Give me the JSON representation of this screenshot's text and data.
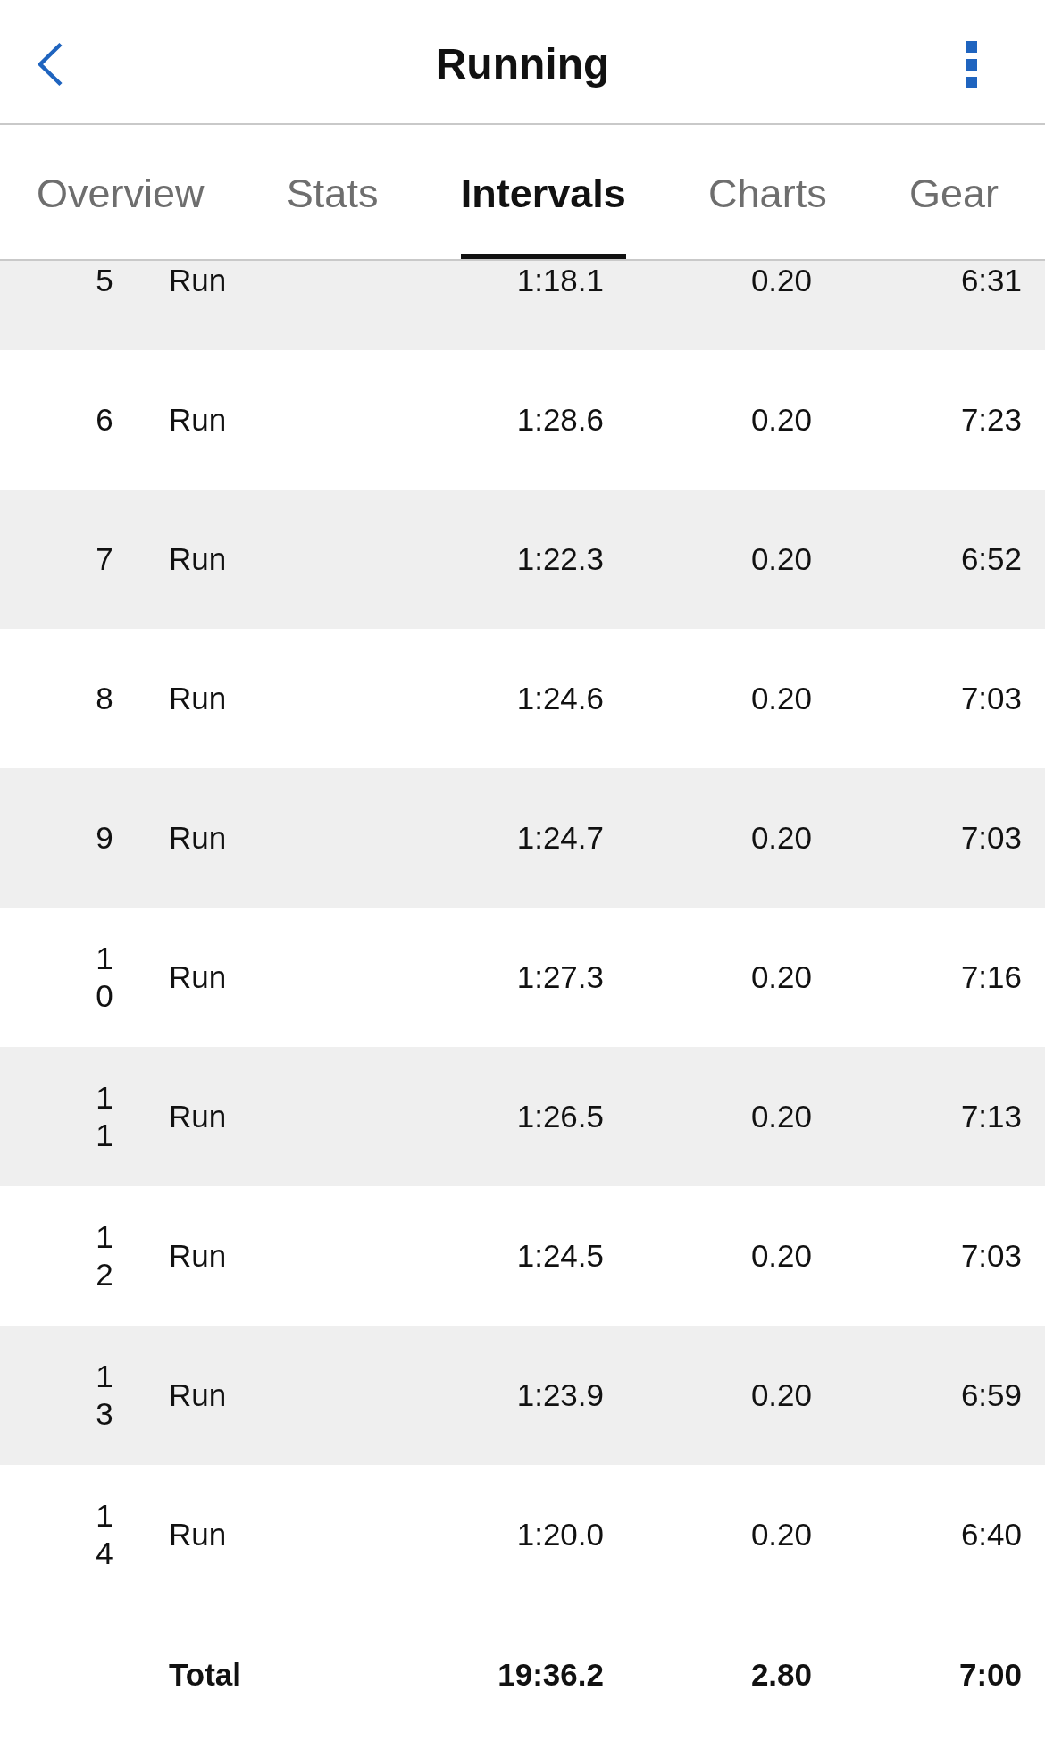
{
  "header": {
    "title": "Running"
  },
  "tabs": [
    {
      "label": "Overview",
      "selected": false
    },
    {
      "label": "Stats",
      "selected": false
    },
    {
      "label": "Intervals",
      "selected": true
    },
    {
      "label": "Charts",
      "selected": false
    },
    {
      "label": "Gear",
      "selected": false
    }
  ],
  "table": {
    "rows": [
      {
        "cells": [
          "5",
          "Run",
          "1:18.1",
          "0.20",
          "6:31"
        ]
      },
      {
        "cells": [
          "6",
          "Run",
          "1:28.6",
          "0.20",
          "7:23"
        ]
      },
      {
        "cells": [
          "7",
          "Run",
          "1:22.3",
          "0.20",
          "6:52"
        ]
      },
      {
        "cells": [
          "8",
          "Run",
          "1:24.6",
          "0.20",
          "7:03"
        ]
      },
      {
        "cells": [
          "9",
          "Run",
          "1:24.7",
          "0.20",
          "7:03"
        ]
      },
      {
        "cells": [
          "10",
          "Run",
          "1:27.3",
          "0.20",
          "7:16"
        ]
      },
      {
        "cells": [
          "11",
          "Run",
          "1:26.5",
          "0.20",
          "7:13"
        ]
      },
      {
        "cells": [
          "12",
          "Run",
          "1:24.5",
          "0.20",
          "7:03"
        ]
      },
      {
        "cells": [
          "13",
          "Run",
          "1:23.9",
          "0.20",
          "6:59"
        ]
      },
      {
        "cells": [
          "14",
          "Run",
          "1:20.0",
          "0.20",
          "6:40"
        ]
      }
    ],
    "total": {
      "label": "Total",
      "cells": [
        "19:36.2",
        "2.80",
        "7:00"
      ]
    }
  }
}
